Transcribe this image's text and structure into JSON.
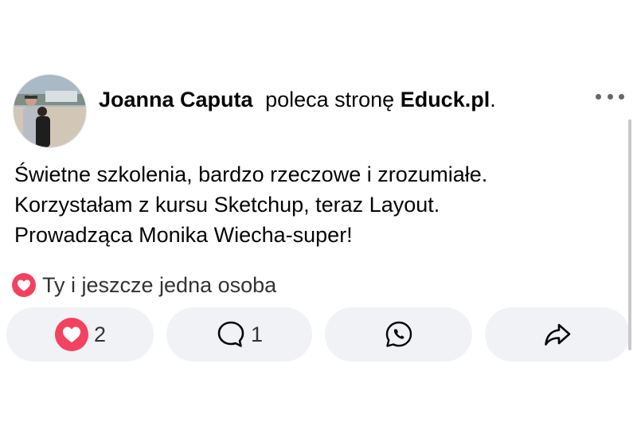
{
  "post": {
    "author": "Joanna Caputa",
    "action": "poleca stronę",
    "page": "Educk.pl",
    "period": ".",
    "body_lines": [
      "Świetne szkolenia, bardzo rzeczowe i zrozumiałe.",
      "Korzystałam z kursu Sketchup,  teraz Layout.",
      "Prowadząca Monika Wiecha-super!"
    ],
    "reactions_summary": "Ty i jeszcze jedna osoba"
  },
  "actions": {
    "like_count": "2",
    "comment_count": "1"
  },
  "icons": {
    "more": "more-dots-icon",
    "reaction": "heart-reaction-icon",
    "comment": "comment-bubble-icon",
    "whatsapp": "whatsapp-icon",
    "share": "share-arrow-icon"
  },
  "colors": {
    "heart": "#f3425f",
    "button_bg": "#f0f2f5",
    "muted": "#65676b"
  }
}
